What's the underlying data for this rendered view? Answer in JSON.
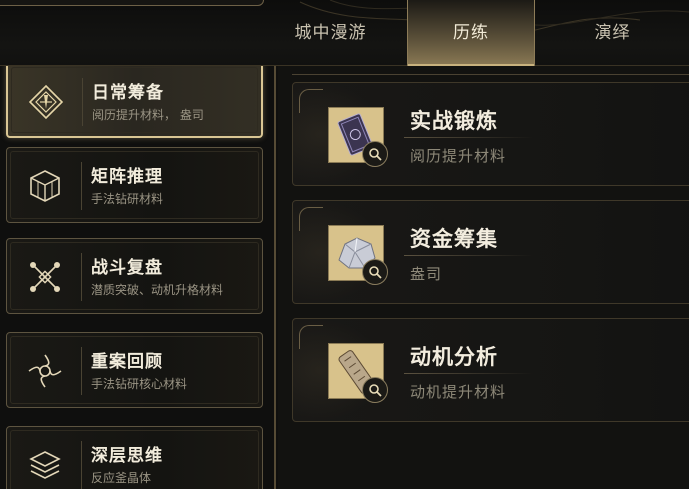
{
  "tabs": [
    {
      "label": "城中漫游",
      "active": false
    },
    {
      "label": "历练",
      "active": true
    },
    {
      "label": "演绎",
      "active": false
    }
  ],
  "sidebar": {
    "items": [
      {
        "title": "日常筹备",
        "subtitle": "阅历提升材料， 盎司",
        "icon": "compass-diamond-icon",
        "active": true
      },
      {
        "title": "矩阵推理",
        "subtitle": "手法钻研材料",
        "icon": "cube-lattice-icon",
        "active": false
      },
      {
        "title": "战斗复盘",
        "subtitle": "潜质突破、动机升格材料",
        "icon": "crossed-network-icon",
        "active": false
      },
      {
        "title": "重案回顾",
        "subtitle": "手法钻研核心材料",
        "icon": "vortex-icon",
        "active": false
      },
      {
        "title": "深层思维",
        "subtitle": "反应釜晶体",
        "icon": "stacked-layers-icon",
        "active": false
      }
    ]
  },
  "cards": [
    {
      "title": "实战锻炼",
      "subtitle": "阅历提升材料",
      "item_icon": "book-icon"
    },
    {
      "title": "资金筹集",
      "subtitle": "盎司",
      "item_icon": "silver-ore-icon"
    },
    {
      "title": "动机分析",
      "subtitle": "动机提升材料",
      "item_icon": "scroll-icon"
    }
  ],
  "colors": {
    "accent_gold": "#d9c694",
    "background": "#0f0f0e",
    "text_primary": "#f2ecdc",
    "text_secondary": "#9a9484"
  }
}
